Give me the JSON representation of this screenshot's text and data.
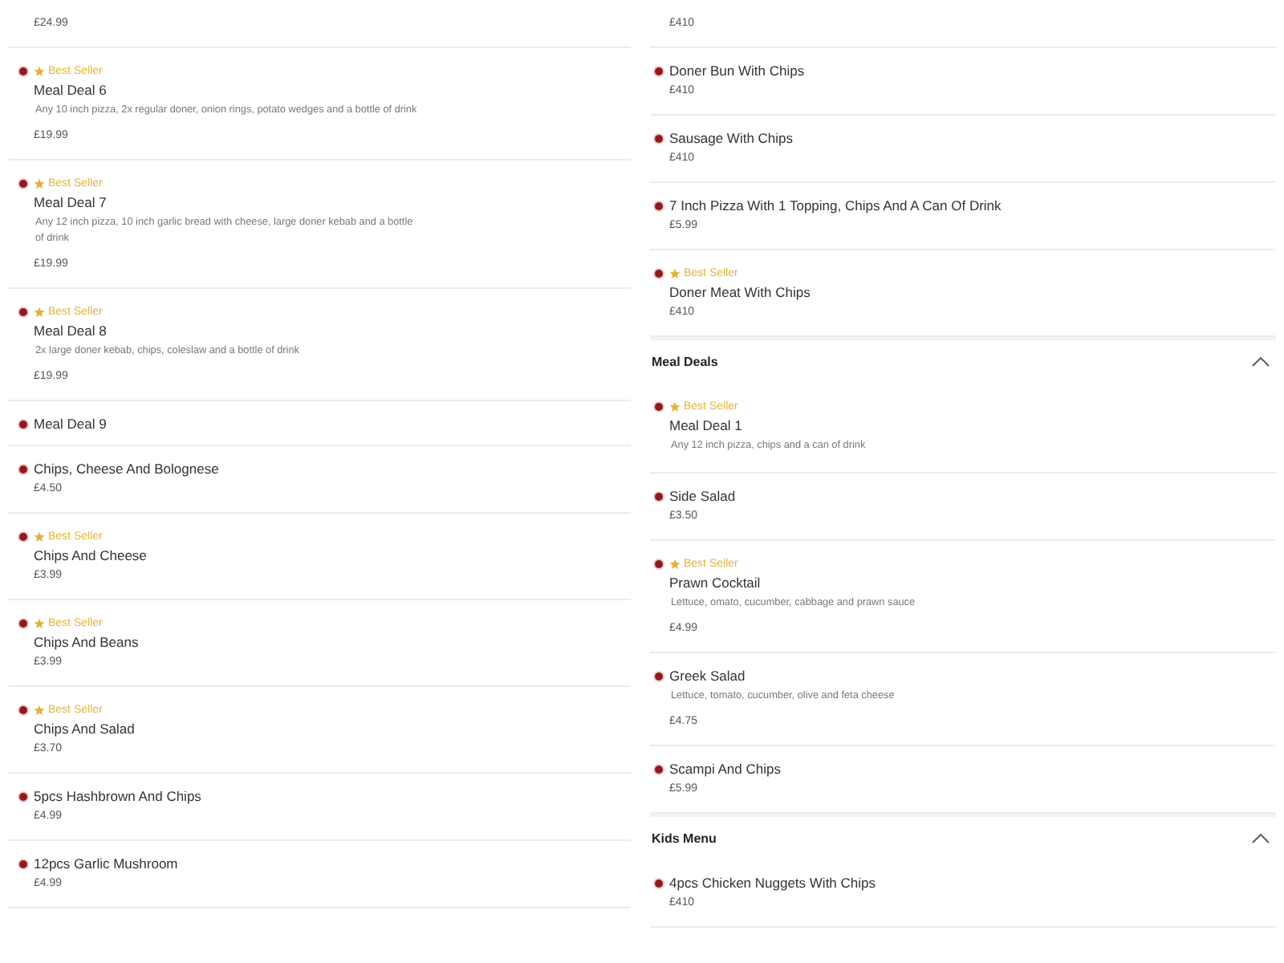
{
  "columns": [
    {
      "entries": [
        {
          "kind": "item",
          "price": "£24.99"
        },
        {
          "kind": "item",
          "badge": "Best Seller",
          "name": "Meal Deal 6",
          "description": "Any 10 inch pizza, 2x regular doner, onion rings, potato wedges and a bottle of drink",
          "price": "£19.99"
        },
        {
          "kind": "item",
          "badge": "Best Seller",
          "name": "Meal Deal 7",
          "description": "Any 12 inch pizza, 10 inch garlic bread with cheese, large doner kebab and a bottle of drink",
          "price": "£19.99"
        },
        {
          "kind": "item",
          "badge": "Best Seller",
          "name": "Meal Deal 8",
          "description": "2x large doner kebab, chips, coleslaw and a bottle of drink",
          "price": "£19.99"
        },
        {
          "kind": "item",
          "name": "Meal Deal 9"
        },
        {
          "kind": "item",
          "name": "Chips, Cheese And Bolognese",
          "price": "£4.50"
        },
        {
          "kind": "item",
          "badge": "Best Seller",
          "name": "Chips And Cheese",
          "price": "£3.99"
        },
        {
          "kind": "item",
          "badge": "Best Seller",
          "name": "Chips And Beans",
          "price": "£3.99"
        },
        {
          "kind": "item",
          "badge": "Best Seller",
          "name": "Chips And Salad",
          "price": "£3.70"
        },
        {
          "kind": "item",
          "name": "5pcs Hashbrown And Chips",
          "price": "£4.99"
        },
        {
          "kind": "item",
          "name": "12pcs Garlic Mushroom",
          "price": "£4.99"
        }
      ]
    },
    {
      "entries": [
        {
          "kind": "item",
          "price": "£410"
        },
        {
          "kind": "item",
          "name": "Doner Bun With Chips",
          "price": "£410"
        },
        {
          "kind": "item",
          "name": "Sausage With Chips",
          "price": "£410"
        },
        {
          "kind": "item",
          "name": "7 Inch Pizza With 1 Topping, Chips And A Can Of Drink",
          "price": "£5.99"
        },
        {
          "kind": "item",
          "badge": "Best Seller",
          "name": "Doner Meat With Chips",
          "price": "£410"
        },
        {
          "kind": "header",
          "title": "Meal Deals",
          "expanded": true
        },
        {
          "kind": "item",
          "badge": "Best Seller",
          "name": "Meal Deal 1",
          "description": "Any 12 inch pizza, chips and a can of drink"
        },
        {
          "kind": "item",
          "name": "Side Salad",
          "price": "£3.50"
        },
        {
          "kind": "item",
          "badge": "Best Seller",
          "name": "Prawn Cocktail",
          "description": "Lettuce, omato, cucumber, cabbage and prawn sauce",
          "price": "£4.99"
        },
        {
          "kind": "item",
          "name": "Greek Salad",
          "description": "Lettuce, tomato, cucumber, olive and feta cheese",
          "price": "£4.75"
        },
        {
          "kind": "item",
          "name": "Scampi And Chips",
          "price": "£5.99"
        },
        {
          "kind": "header",
          "title": "Kids Menu",
          "expanded": true
        },
        {
          "kind": "item",
          "name": "4pcs Chicken Nuggets With Chips",
          "price": "£410"
        }
      ]
    }
  ]
}
